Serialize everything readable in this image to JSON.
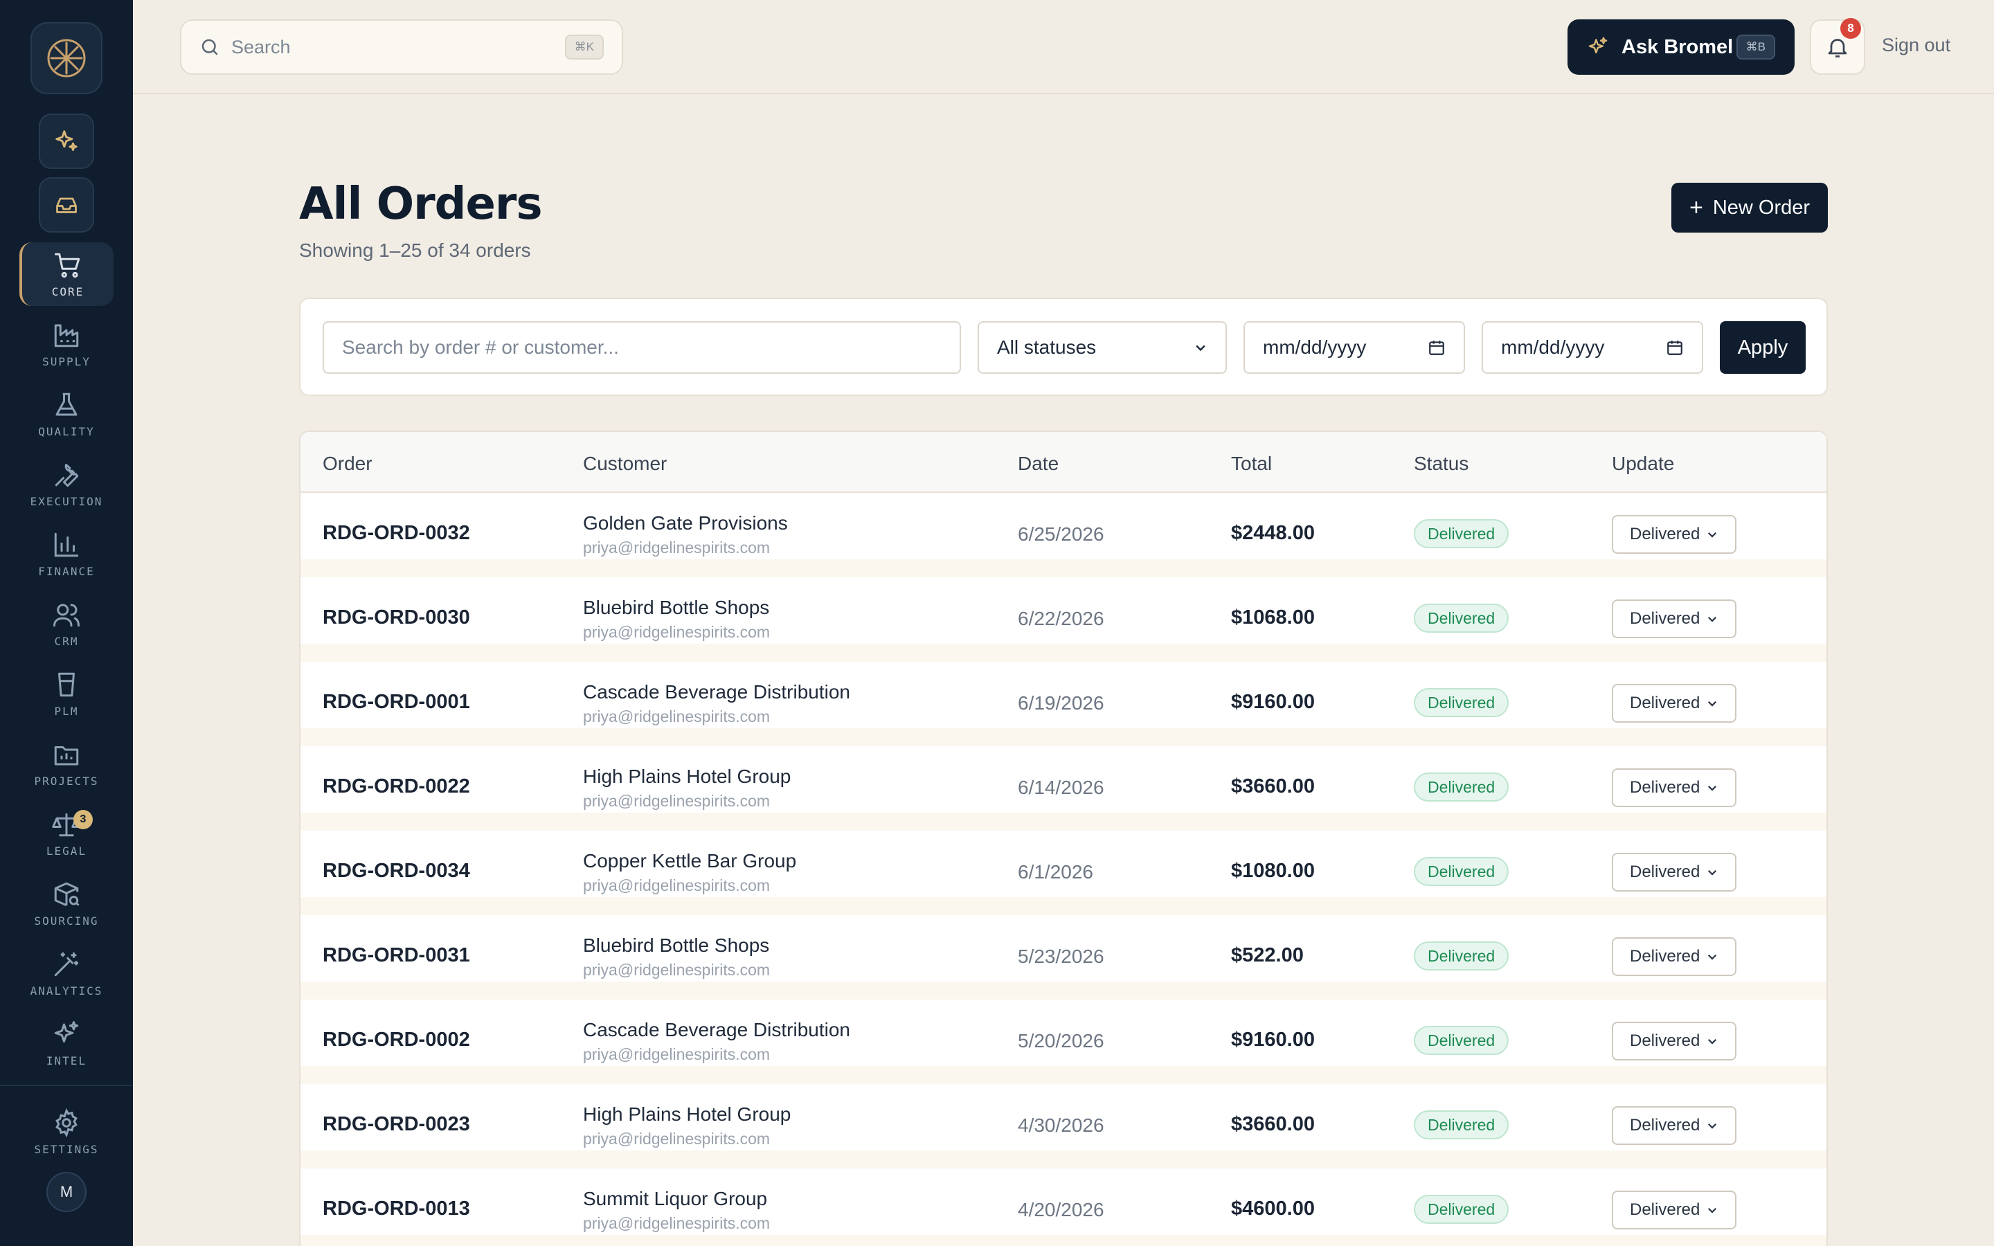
{
  "sidebar": {
    "items": [
      {
        "label": "CORE",
        "icon": "cart-icon",
        "active": true
      },
      {
        "label": "SUPPLY",
        "icon": "factory-icon"
      },
      {
        "label": "QUALITY",
        "icon": "flask-icon"
      },
      {
        "label": "EXECUTION",
        "icon": "wrench-icon"
      },
      {
        "label": "FINANCE",
        "icon": "bar-chart-icon"
      },
      {
        "label": "CRM",
        "icon": "users-icon"
      },
      {
        "label": "PLM",
        "icon": "cup-icon"
      },
      {
        "label": "PROJECTS",
        "icon": "folder-chart-icon"
      },
      {
        "label": "LEGAL",
        "icon": "scale-icon",
        "badge": "3"
      },
      {
        "label": "SOURCING",
        "icon": "package-search-icon"
      },
      {
        "label": "ANALYTICS",
        "icon": "wand-icon"
      },
      {
        "label": "INTEL",
        "icon": "sparkles-icon"
      }
    ],
    "settings_label": "SETTINGS",
    "avatar_initial": "M"
  },
  "topbar": {
    "search_placeholder": "Search",
    "search_shortcut": "⌘K",
    "ask_label": "Ask Bromel",
    "ask_shortcut": "⌘B",
    "notification_count": "8",
    "signout_label": "Sign out"
  },
  "page": {
    "title": "All Orders",
    "subtitle": "Showing 1–25 of 34 orders",
    "new_order_label": "New Order"
  },
  "filters": {
    "search_placeholder": "Search by order # or customer...",
    "status_value": "All statuses",
    "date_from": "mm/dd/yyyy",
    "date_to": "mm/dd/yyyy",
    "apply_label": "Apply"
  },
  "table": {
    "headers": [
      "Order",
      "Customer",
      "Date",
      "Total",
      "Status",
      "Update"
    ],
    "rows": [
      {
        "order": "RDG-ORD-0032",
        "customer": "Golden Gate Provisions",
        "email": "priya@ridgelinespirits.com",
        "date": "6/25/2026",
        "total": "$2448.00",
        "status": "Delivered",
        "update": "Delivered"
      },
      {
        "order": "RDG-ORD-0030",
        "customer": "Bluebird Bottle Shops",
        "email": "priya@ridgelinespirits.com",
        "date": "6/22/2026",
        "total": "$1068.00",
        "status": "Delivered",
        "update": "Delivered"
      },
      {
        "order": "RDG-ORD-0001",
        "customer": "Cascade Beverage Distribution",
        "email": "priya@ridgelinespirits.com",
        "date": "6/19/2026",
        "total": "$9160.00",
        "status": "Delivered",
        "update": "Delivered"
      },
      {
        "order": "RDG-ORD-0022",
        "customer": "High Plains Hotel Group",
        "email": "priya@ridgelinespirits.com",
        "date": "6/14/2026",
        "total": "$3660.00",
        "status": "Delivered",
        "update": "Delivered"
      },
      {
        "order": "RDG-ORD-0034",
        "customer": "Copper Kettle Bar Group",
        "email": "priya@ridgelinespirits.com",
        "date": "6/1/2026",
        "total": "$1080.00",
        "status": "Delivered",
        "update": "Delivered"
      },
      {
        "order": "RDG-ORD-0031",
        "customer": "Bluebird Bottle Shops",
        "email": "priya@ridgelinespirits.com",
        "date": "5/23/2026",
        "total": "$522.00",
        "status": "Delivered",
        "update": "Delivered"
      },
      {
        "order": "RDG-ORD-0002",
        "customer": "Cascade Beverage Distribution",
        "email": "priya@ridgelinespirits.com",
        "date": "5/20/2026",
        "total": "$9160.00",
        "status": "Delivered",
        "update": "Delivered"
      },
      {
        "order": "RDG-ORD-0023",
        "customer": "High Plains Hotel Group",
        "email": "priya@ridgelinespirits.com",
        "date": "4/30/2026",
        "total": "$3660.00",
        "status": "Delivered",
        "update": "Delivered"
      },
      {
        "order": "RDG-ORD-0013",
        "customer": "Summit Liquor Group",
        "email": "priya@ridgelinespirits.com",
        "date": "4/20/2026",
        "total": "$4600.00",
        "status": "Delivered",
        "update": "Delivered"
      }
    ]
  },
  "colors": {
    "sidebar_bg": "#0f1d2e",
    "accent_gold": "#c8a06a",
    "page_bg": "#f2ede4",
    "status_green": "#1c8a52"
  }
}
